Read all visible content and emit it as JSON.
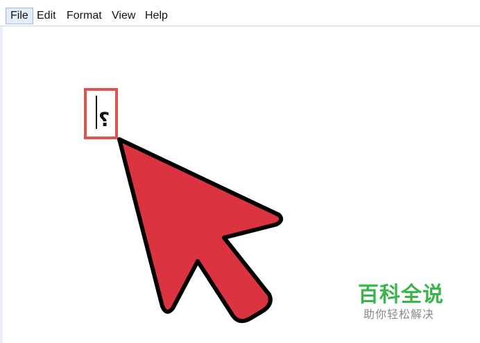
{
  "menubar": {
    "items": [
      {
        "label": "File",
        "active": true
      },
      {
        "label": "Edit",
        "active": false
      },
      {
        "label": "Format",
        "active": false
      },
      {
        "label": "View",
        "active": false
      },
      {
        "label": "Help",
        "active": false
      }
    ]
  },
  "editor": {
    "text": "؟"
  },
  "annotation": {
    "highlight_color": "#e0524f",
    "arrow_fill": "#dc3340",
    "arrow_stroke": "#000000"
  },
  "watermark": {
    "title": "百科全说",
    "subtitle": "助你轻松解决"
  }
}
